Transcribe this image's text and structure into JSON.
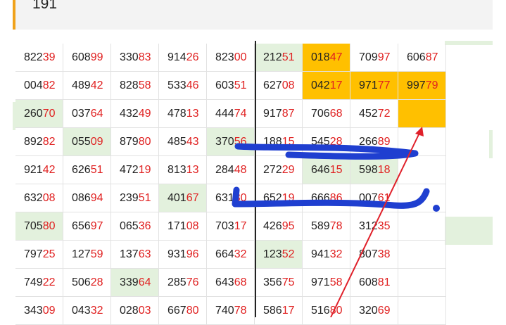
{
  "header": {
    "text": "191"
  },
  "colors": {
    "accent": "#f0a21a",
    "highlight_green": "#e3f1dd",
    "highlight_orange": "#ffc000",
    "digit_red": "#e02020",
    "pen_blue": "#1f3fd0",
    "arrow_red": "#e0202a"
  },
  "rows": [
    [
      "82239",
      "60899",
      "33083",
      "91426",
      "82300",
      "21251",
      "01847",
      "70997",
      "60687"
    ],
    [
      "00482",
      "48942",
      "82858",
      "53346",
      "60351",
      "62708",
      "04217",
      "97177",
      "99779"
    ],
    [
      "26070",
      "03764",
      "43249",
      "47813",
      "44474",
      "91787",
      "70668",
      "45272",
      ""
    ],
    [
      "89282",
      "05509",
      "87980",
      "48543",
      "37056",
      "18815",
      "54528",
      "26689",
      ""
    ],
    [
      "92142",
      "62651",
      "47219",
      "81313",
      "28448",
      "27229",
      "64615",
      "59818",
      ""
    ],
    [
      "63208",
      "08694",
      "23951",
      "40167",
      "63180",
      "65219",
      "66686",
      "00761",
      ""
    ],
    [
      "70580",
      "65697",
      "06536",
      "17108",
      "70317",
      "42695",
      "58978",
      "31235",
      ""
    ],
    [
      "79725",
      "12759",
      "13763",
      "93196",
      "66432",
      "12352",
      "94132",
      "80738",
      ""
    ],
    [
      "74922",
      "50628",
      "33964",
      "28576",
      "64368",
      "35675",
      "97158",
      "60881",
      ""
    ],
    [
      "34309",
      "04332",
      "02803",
      "66780",
      "74078",
      "58617",
      "51680",
      "32069",
      ""
    ]
  ],
  "highlights": {
    "green": [
      [
        0,
        5
      ],
      [
        2,
        0
      ],
      [
        3,
        1
      ],
      [
        3,
        4
      ],
      [
        4,
        6
      ],
      [
        4,
        7
      ],
      [
        5,
        3
      ],
      [
        6,
        0
      ],
      [
        7,
        5
      ],
      [
        8,
        2
      ]
    ],
    "orange": [
      [
        0,
        6
      ],
      [
        1,
        6
      ],
      [
        1,
        7
      ],
      [
        1,
        8
      ],
      [
        2,
        8
      ]
    ]
  },
  "annotations": [
    "blue-scribble-row-4",
    "blue-scribble-row-6",
    "red-arrow-up-right"
  ]
}
